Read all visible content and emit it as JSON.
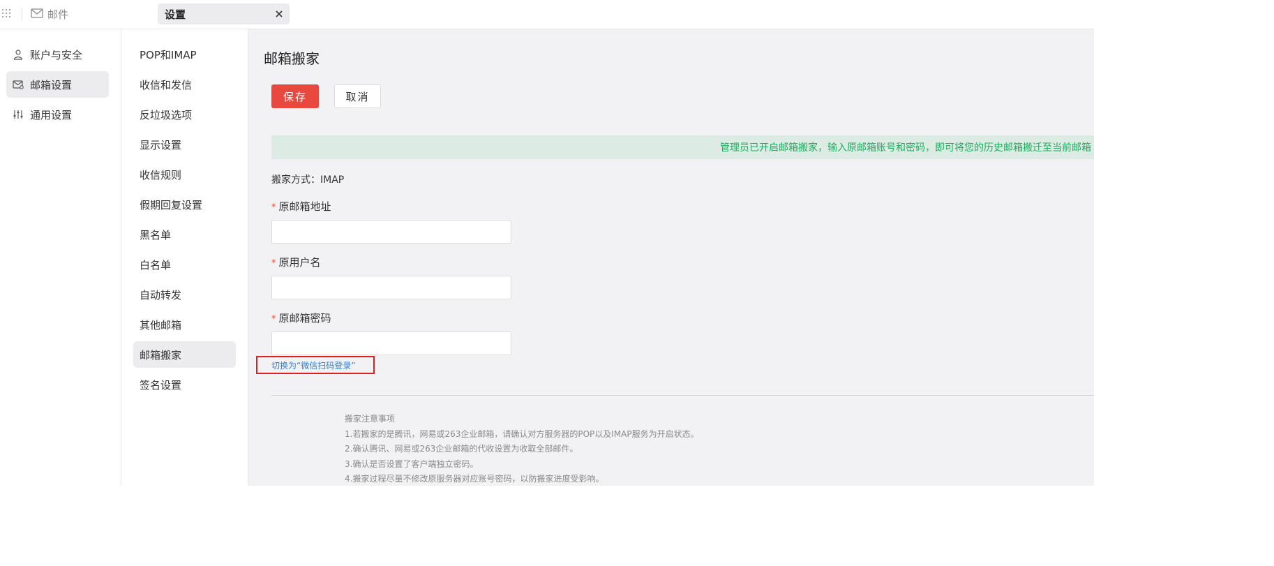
{
  "topbar": {
    "mail_label": "邮件",
    "tab_label": "设置"
  },
  "sidebar": {
    "items": [
      {
        "label": "账户与安全",
        "icon": "user-icon"
      },
      {
        "label": "邮箱设置",
        "icon": "mailbox-settings-icon",
        "active": true
      },
      {
        "label": "通用设置",
        "icon": "sliders-icon"
      }
    ]
  },
  "midnav": {
    "items": [
      {
        "label": "POP和IMAP"
      },
      {
        "label": "收信和发信"
      },
      {
        "label": "反垃圾选项"
      },
      {
        "label": "显示设置"
      },
      {
        "label": "收信规则"
      },
      {
        "label": "假期回复设置"
      },
      {
        "label": "黑名单"
      },
      {
        "label": "白名单"
      },
      {
        "label": "自动转发"
      },
      {
        "label": "其他邮箱"
      },
      {
        "label": "邮箱搬家",
        "active": true
      },
      {
        "label": "签名设置"
      }
    ]
  },
  "content": {
    "title": "邮箱搬家",
    "save_label": "保存",
    "cancel_label": "取消",
    "notice": "管理员已开启邮箱搬家，输入原邮箱账号和密码，即可将您的历史邮箱搬迁至当前邮箱",
    "method": "搬家方式：IMAP",
    "fields": [
      {
        "label": "原邮箱地址",
        "value": ""
      },
      {
        "label": "原用户名",
        "value": ""
      },
      {
        "label": "原邮箱密码",
        "value": ""
      }
    ],
    "wechat_link": "切换为“微信扫码登录”",
    "notes": [
      "搬家注意事项",
      "1.若搬家的是腾讯，网易或263企业邮箱，请确认对方服务器的POP以及IMAP服务为开启状态。",
      "2.确认腾讯、网易或263企业邮箱的代收设置为收取全部邮件。",
      "3.确认是否设置了客户端独立密码。",
      "4.搬家过程尽量不修改原服务器对应账号密码，以防搬家进度受影响。"
    ]
  },
  "colors": {
    "primary": "#e9483f",
    "notice_bg": "#dcece4",
    "notice_text": "#1cad5e",
    "link": "#2a7fd5",
    "highlight_border": "#e02020"
  }
}
